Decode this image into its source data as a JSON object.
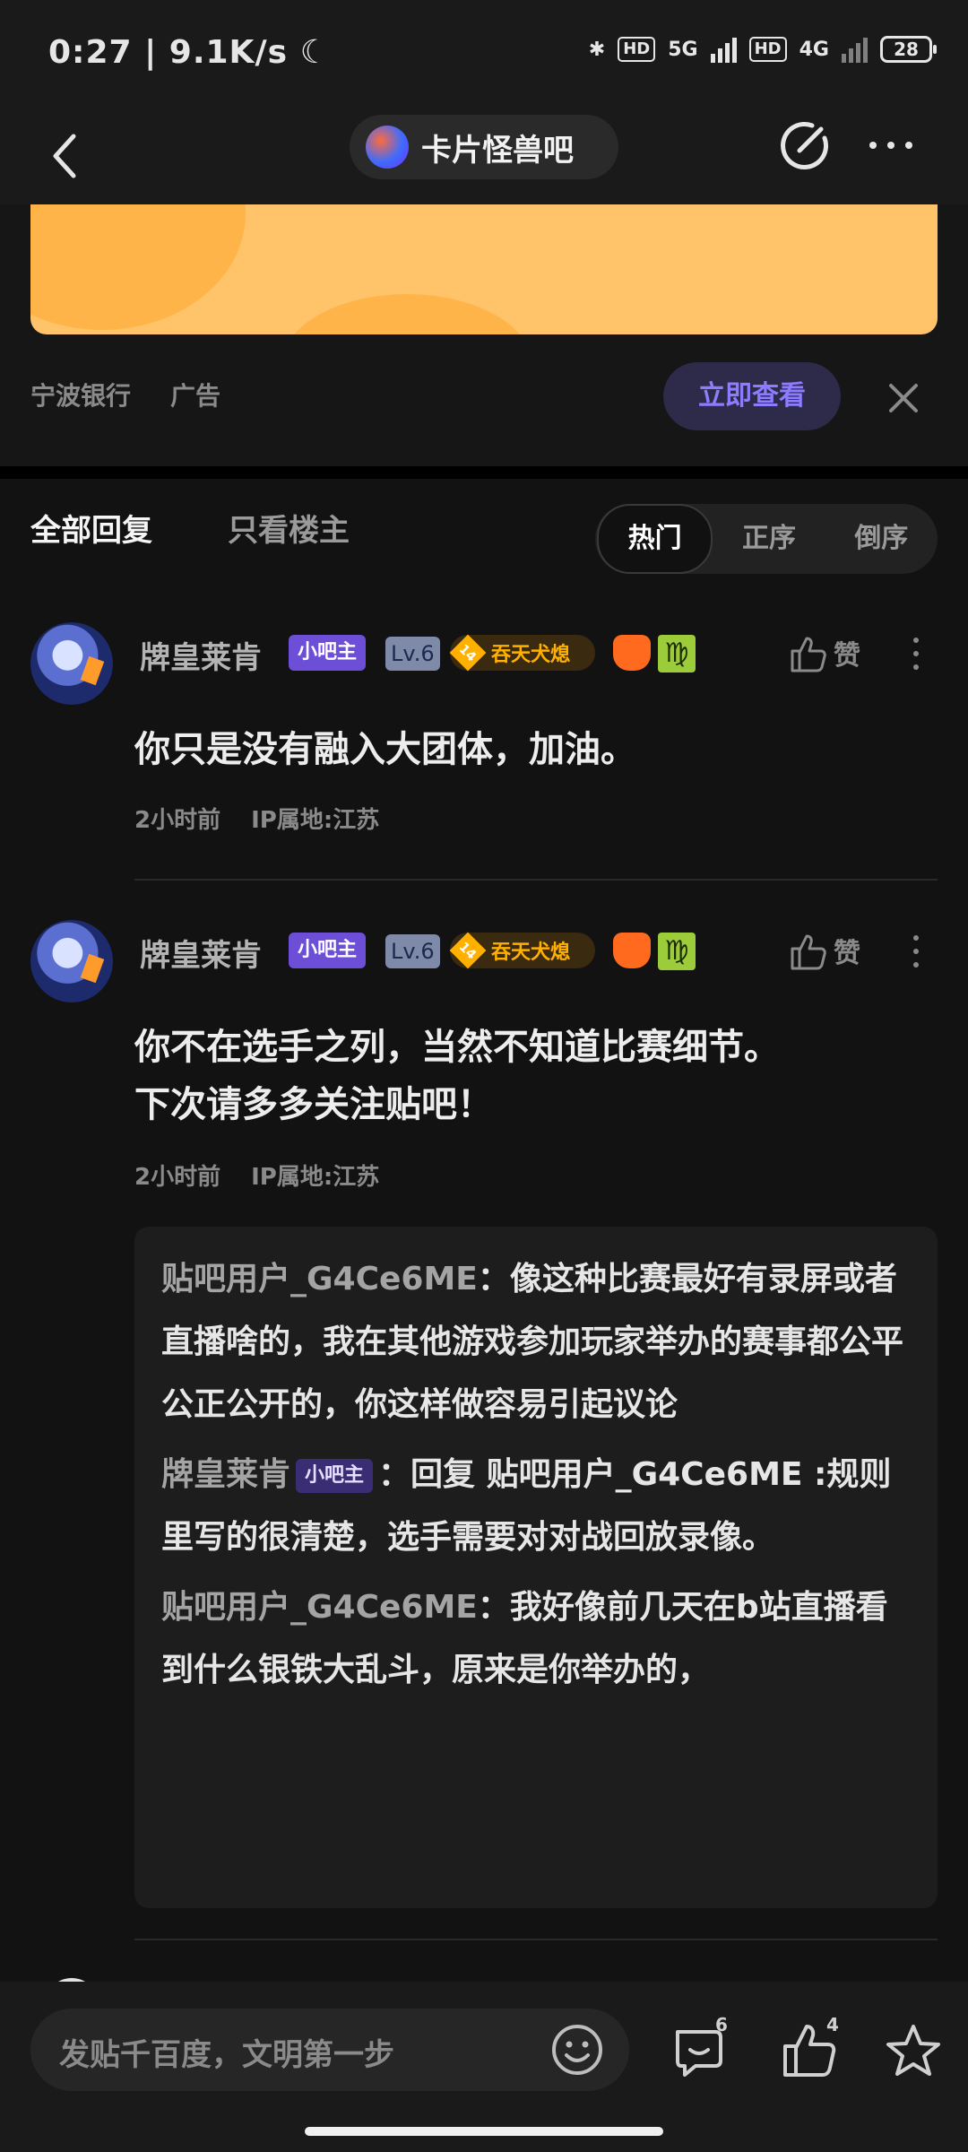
{
  "status_bar": {
    "time": "0:27",
    "speed": "9.1K/s",
    "hd1": "HD",
    "net1": "5G",
    "hd2": "HD",
    "net2": "4G",
    "battery": "28"
  },
  "nav": {
    "forum_name": "卡片怪兽吧"
  },
  "ad": {
    "sponsor": "宁波银行",
    "tag": "广告",
    "cta": "立即查看"
  },
  "filter": {
    "tab_all": "全部回复",
    "tab_op": "只看楼主",
    "sort": [
      "热门",
      "正序",
      "倒序"
    ],
    "active_sort": "热门"
  },
  "comments": [
    {
      "username": "牌皇莱肯",
      "owner_badge": "小吧主",
      "level": "Lv.6",
      "title_level": "14",
      "title_text": "吞天犬熄",
      "like_label": "赞",
      "body": "你只是没有融入大团体，加油。",
      "time": "2小时前",
      "ip": "IP属地:江苏"
    },
    {
      "username": "牌皇莱肯",
      "owner_badge": "小吧主",
      "level": "Lv.6",
      "title_level": "14",
      "title_text": "吞天犬熄",
      "like_label": "赞",
      "body_line1": "你不在选手之列，当然不知道比赛细节。",
      "body_line2": "下次请多多关注贴吧！",
      "time": "2小时前",
      "ip": "IP属地:江苏"
    }
  ],
  "sub_replies": [
    {
      "user": "贴吧用户_G4Ce6ME",
      "sep": "：",
      "text": "像这种比赛最好有录屏或者直播啥的，我在其他游戏参加玩家举办的赛事都公平公正公开的，你这样做容易引起议论"
    },
    {
      "user": "牌皇莱肯",
      "owner_badge": "小吧主",
      "sep": "：",
      "text": "回复 贴吧用户_G4Ce6ME :规则里写的很清楚，选手需要对对战回放录像。"
    },
    {
      "user": "贴吧用户_G4Ce6ME",
      "sep": "：",
      "text": "我好像前几天在b站直播看到什么银铁大乱斗，原来是你举办的，"
    }
  ],
  "bottom_bar": {
    "placeholder": "发贴千百度，文明第一步",
    "comment_count": "6",
    "like_count": "4"
  }
}
